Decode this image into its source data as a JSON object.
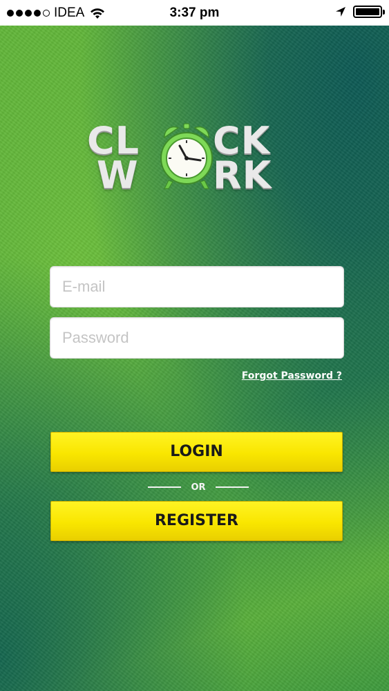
{
  "status_bar": {
    "carrier": "IDEA",
    "time": "3:37 pm",
    "signal_bars_filled": 4,
    "signal_bars_total": 5,
    "icons": [
      "signal-dots-icon",
      "wifi-icon",
      "location-arrow-icon",
      "battery-icon"
    ],
    "battery_level": 1.0
  },
  "logo": {
    "line1_left": "CL",
    "line1_right": "CK",
    "line2_left": "W",
    "line2_right": "RK",
    "clock_icon": "alarm-clock-icon"
  },
  "login_form": {
    "email_placeholder": "E-mail",
    "email_value": "",
    "password_placeholder": "Password",
    "password_value": "",
    "forgot_password": "Forgot Password ?",
    "login_label": "LOGIN",
    "or_label": "OR",
    "register_label": "REGISTER"
  },
  "colors": {
    "button_yellow": "#f9e600",
    "background_green": "#4ea43a",
    "background_dark_teal": "#0d5a55",
    "logo_silver": "#e9e9e9",
    "clock_green": "#7ed957"
  }
}
